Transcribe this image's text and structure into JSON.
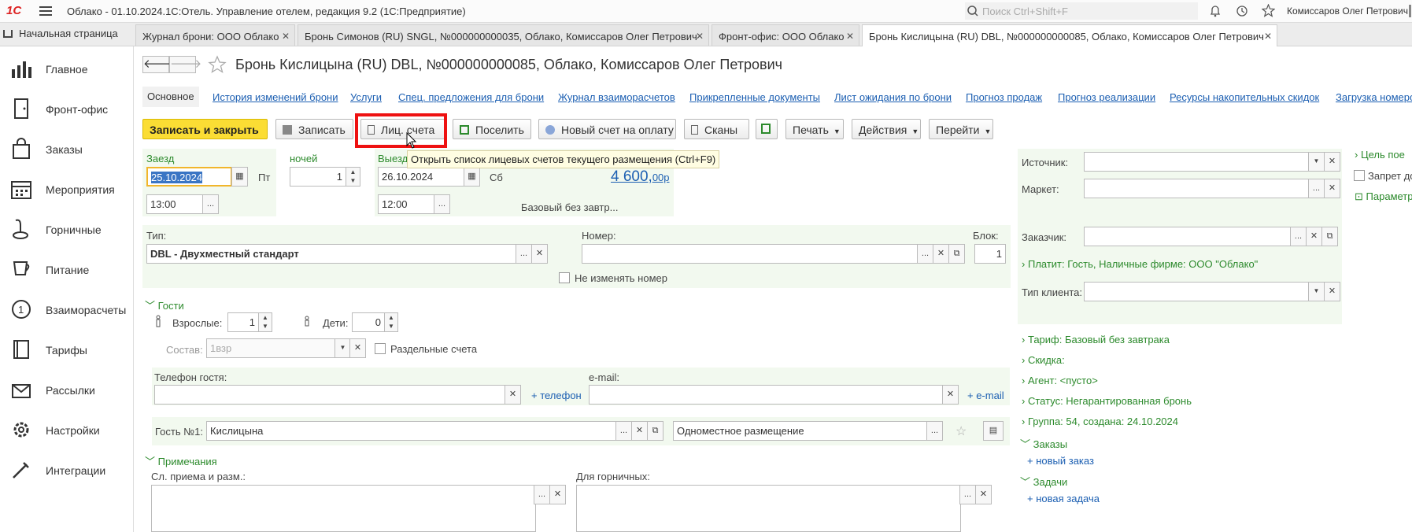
{
  "app": {
    "logo": "1С",
    "title": "Облако - 01.10.2024.1С:Отель. Управление отелем, редакция 9.2  (1С:Предприятие)",
    "search_placeholder": "Поиск Ctrl+Shift+F",
    "user": "Комиссаров Олег Петрович"
  },
  "tabs": [
    {
      "label": "Начальная страница"
    },
    {
      "label": "Журнал брони: ООО Облако"
    },
    {
      "label": "Бронь Симонов (RU) SNGL, №000000000035, Облако, Комиссаров Олег Петрович"
    },
    {
      "label": "Фронт-офис: ООО Облако"
    },
    {
      "label": "Бронь Кислицына (RU) DBL, №000000000085, Облако, Комиссаров Олег Петрович"
    }
  ],
  "sidebar": [
    {
      "label": "Главное"
    },
    {
      "label": "Фронт-офис"
    },
    {
      "label": "Заказы"
    },
    {
      "label": "Мероприятия"
    },
    {
      "label": "Горничные"
    },
    {
      "label": "Питание"
    },
    {
      "label": "Взаиморасчеты"
    },
    {
      "label": "Тарифы"
    },
    {
      "label": "Рассылки"
    },
    {
      "label": "Настройки"
    },
    {
      "label": "Интеграции"
    }
  ],
  "form": {
    "title": "Бронь Кислицына (RU) DBL, №000000000085, Облако, Комиссаров Олег Петрович",
    "subtabs": [
      "Основное",
      "История изменений брони",
      "Услуги",
      "Спец. предложения для брони",
      "Журнал взаиморасчетов",
      "Прикрепленные документы",
      "Лист ожидания по брони",
      "Прогноз продаж",
      "Прогноз реализации",
      "Ресурсы накопительных скидок",
      "Загрузка номеро"
    ],
    "toolbar": {
      "save_close": "Записать и закрыть",
      "save": "Записать",
      "accounts": "Лиц. счета",
      "settle": "Поселить",
      "new_invoice": "Новый счет на оплату",
      "scans": "Сканы",
      "print": "Печать",
      "actions": "Действия",
      "goto": "Перейти"
    },
    "tooltip": "Открыть список лицевых счетов текущего размещения (Ctrl+F9)",
    "checkin": {
      "label": "Заезд",
      "date": "25.10.2024",
      "weekday": "Пт",
      "time": "13:00"
    },
    "nights": {
      "label": "ночей",
      "value": "1"
    },
    "checkout": {
      "label": "Выезд",
      "date": "26.10.2024",
      "weekday": "Сб",
      "time": "12:00"
    },
    "price": {
      "value": "4 600,",
      "cents": "00р",
      "rate": "Базовый без завтр..."
    },
    "type": {
      "label": "Тип:",
      "value": "DBL - Двухместный стандарт"
    },
    "room": {
      "label": "Номер:",
      "value": "",
      "keep_label": "Не изменять номер"
    },
    "block": {
      "label": "Блок:",
      "value": "1"
    },
    "guests": {
      "section": "Гости",
      "adults_label": "Взрослые:",
      "adults": "1",
      "children_label": "Дети:",
      "children": "0",
      "composition_label": "Состав:",
      "composition": "1взр",
      "separate_label": "Раздельные счета"
    },
    "phone": {
      "label": "Телефон гостя:",
      "value": "",
      "add": "+ телефон"
    },
    "email": {
      "label": "e-mail:",
      "value": "",
      "add": "+ e-mail"
    },
    "guest1": {
      "label": "Гость №1:",
      "name": "Кислицына",
      "placement": "Одноместное размещение"
    },
    "notes": {
      "section": "Примечания",
      "reception_label": "Сл. приема и разм.:",
      "maids_label": "Для горничных:"
    }
  },
  "right": {
    "source_label": "Источник:",
    "market_label": "Маркет:",
    "customer_label": "Заказчик:",
    "payer": "Платит: Гость, Наличные фирме: ООО \"Облако\"",
    "client_type_label": "Тип клиента:",
    "tariff": "Тариф: Базовый без завтрака",
    "discount": "Скидка:",
    "agent": "Агент: <пусто>",
    "status": "Статус: Негарантированная бронь",
    "group": "Группа: 54, создана: 24.10.2024",
    "orders": "Заказы",
    "new_order": "+ новый заказ",
    "tasks": "Задачи",
    "new_task": "+ новая задача"
  },
  "far_right": {
    "purpose": "Цель пое",
    "ban": "Запрет до",
    "params": "Параметр"
  }
}
